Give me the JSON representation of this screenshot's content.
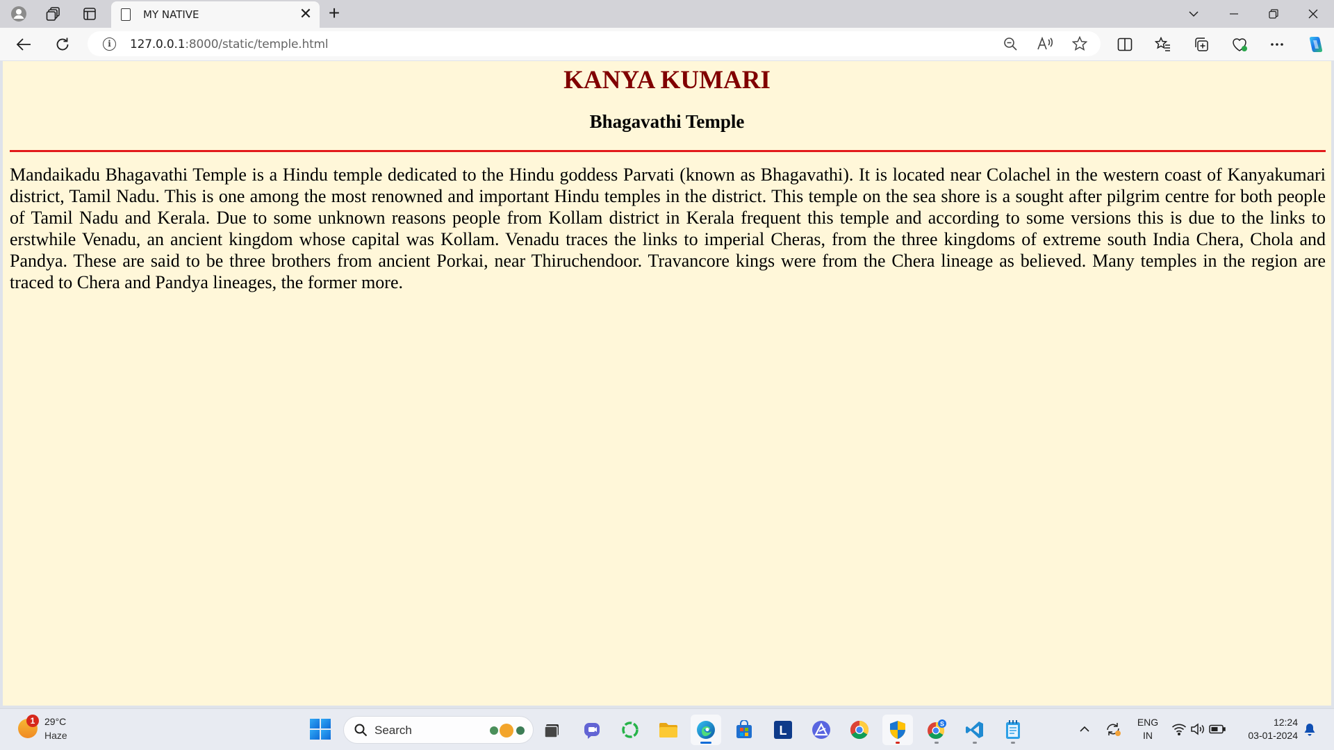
{
  "browser": {
    "tab": {
      "title": "MY NATIVE",
      "close_glyph": "✕"
    },
    "new_tab_glyph": "+",
    "address": {
      "host": "127.0.0.1",
      "path": ":8000/static/temple.html",
      "info_glyph": "i"
    }
  },
  "page": {
    "heading": "KANYA KUMARI",
    "subheading": "Bhagavathi Temple",
    "paragraph": "Mandaikadu Bhagavathi Temple is a Hindu temple dedicated to the Hindu goddess Parvati (known as Bhagavathi). It is located near Colachel in the western coast of Kanyakumari district, Tamil Nadu. This is one among the most renowned and important Hindu temples in the district. This temple on the sea shore is a sought after pilgrim centre for both people of Tamil Nadu and Kerala. Due to some unknown reasons people from Kollam district in Kerala frequent this temple and according to some versions this is due to the links to erstwhile Venadu, an ancient kingdom whose capital was Kollam. Venadu traces the links to imperial Cheras, from the three kingdoms of extreme south India Chera, Chola and Pandya. These are said to be three brothers from ancient Porkai, near Thiruchendoor. Travancore kings were from the Chera lineage as believed. Many temples in the region are traced to Chera and Pandya lineages, the former more."
  },
  "taskbar": {
    "weather": {
      "temp": "29°C",
      "desc": "Haze",
      "badge": "1"
    },
    "search_label": "Search",
    "lang_line1": "ENG",
    "lang_line2": "IN",
    "time": "12:24",
    "date": "03-01-2024",
    "chrome_badge": "S",
    "app_letter_l": "L"
  },
  "colors": {
    "page_background": "#fff7d9",
    "heading": "#800000",
    "rule": "#e21b1b"
  }
}
